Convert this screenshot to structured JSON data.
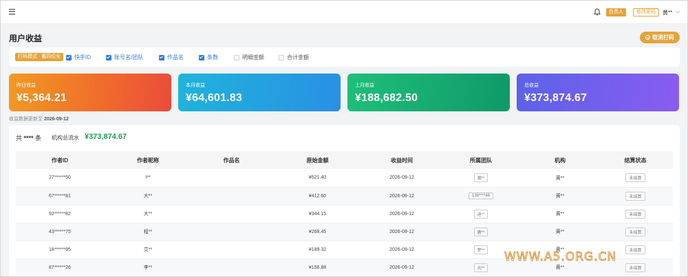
{
  "header": {
    "role_badge": "负责人",
    "change_password": "修改密码",
    "user_name": "黄**",
    "caret": "⌵"
  },
  "page": {
    "title": "用户收益",
    "cancel_print_label": "取消打码"
  },
  "filters": {
    "print_mode": "打码模式 · 戴四位全",
    "options": [
      {
        "label": "快手ID",
        "checked": true
      },
      {
        "label": "账号名/团队",
        "checked": true
      },
      {
        "label": "作品名",
        "checked": true
      },
      {
        "label": "条数",
        "checked": true
      },
      {
        "label": "明细金额",
        "checked": false
      },
      {
        "label": "合计金额",
        "checked": false
      }
    ]
  },
  "stats": [
    {
      "label": "昨日收益",
      "value": "¥5,364.21"
    },
    {
      "label": "本月收益",
      "value": "¥64,601.83"
    },
    {
      "label": "上月收益",
      "value": "¥188,682.50"
    },
    {
      "label": "总收益",
      "value": "¥373,874.67"
    }
  ],
  "update_note": {
    "label": "收益数据更新至",
    "date": "2026-09-12"
  },
  "summary": {
    "prefix": "共",
    "count": "****",
    "suffix": "条",
    "flow_label": "机构总流水",
    "flow_value": "¥373,874.67"
  },
  "table": {
    "columns": [
      "作者ID",
      "作者昵称",
      "作品名",
      "原始金额",
      "收益时间",
      "所属团队",
      "机构",
      "结算状态"
    ],
    "rows": [
      {
        "author_id": "27******50",
        "nickname": "I**",
        "work": "",
        "amount": "¥521.40",
        "time": "2026-09-12",
        "team": "瀚**",
        "org": "黄**",
        "status": "未结算"
      },
      {
        "author_id": "67******81",
        "nickname": "大**",
        "work": "",
        "amount": "¥412.60",
        "time": "2026-09-12",
        "team": "138****46",
        "org": "黄**",
        "status": "未结算"
      },
      {
        "author_id": "92******82",
        "nickname": "大**",
        "work": "",
        "amount": "¥344.15",
        "time": "2026-09-12",
        "team": "迪**",
        "org": "黄**",
        "status": "未结算"
      },
      {
        "author_id": "43******75",
        "nickname": "程**",
        "work": "",
        "amount": "¥268.45",
        "time": "2026-09-12",
        "team": "唐**",
        "org": "黄**",
        "status": "未结算"
      },
      {
        "author_id": "18******95",
        "nickname": "艾**",
        "work": "",
        "amount": "¥189.32",
        "time": "2026-09-12",
        "team": "梦**",
        "org": "黄**",
        "status": "未结算"
      },
      {
        "author_id": "87******26",
        "nickname": "李**",
        "work": "",
        "amount": "¥156.88",
        "time": "2026-09-12",
        "team": "光**",
        "org": "黄**",
        "status": "未结算"
      }
    ]
  },
  "watermark": "WWW.A5.ORG.CN"
}
